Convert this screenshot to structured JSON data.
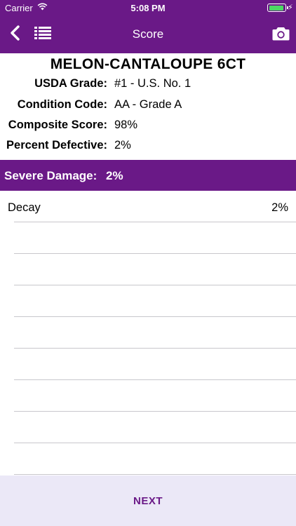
{
  "status_bar": {
    "carrier": "Carrier",
    "time": "5:08 PM",
    "battery_color": "#4cd964"
  },
  "nav": {
    "title": "Score",
    "back_icon": "chevron-left-icon",
    "list_icon": "list-icon",
    "camera_icon": "camera-icon"
  },
  "product": {
    "title": "MELON-CANTALOUPE 6CT"
  },
  "info": [
    {
      "label": "USDA Grade:",
      "value": "#1 - U.S. No. 1"
    },
    {
      "label": "Condition Code:",
      "value": "AA - Grade A"
    },
    {
      "label": "Composite Score:",
      "value": "98%"
    },
    {
      "label": "Percent Defective:",
      "value": "2%"
    }
  ],
  "severe": {
    "label": "Severe Damage:",
    "value": "2%"
  },
  "defects": [
    {
      "name": "Decay",
      "value": "2%"
    },
    {
      "name": "",
      "value": ""
    },
    {
      "name": "",
      "value": ""
    },
    {
      "name": "",
      "value": ""
    },
    {
      "name": "",
      "value": ""
    },
    {
      "name": "",
      "value": ""
    },
    {
      "name": "",
      "value": ""
    },
    {
      "name": "",
      "value": ""
    },
    {
      "name": "",
      "value": ""
    }
  ],
  "footer": {
    "next_label": "NEXT"
  },
  "colors": {
    "accent": "#6a1987",
    "footer_bg": "#ebe8f7"
  }
}
